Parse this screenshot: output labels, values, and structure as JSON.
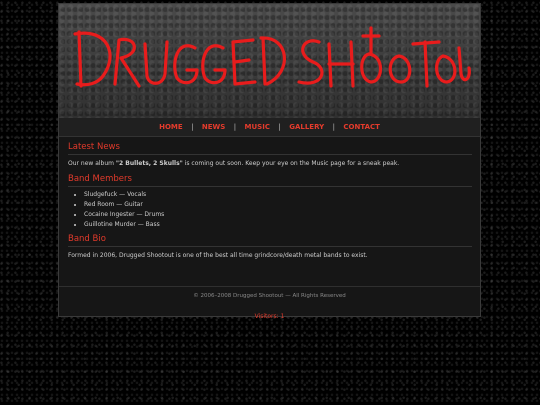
{
  "header": {
    "logo_text": "DRUGGED SHOOTOUT",
    "brand_color": "#e01f1f"
  },
  "nav": {
    "items": [
      {
        "label": "HOME"
      },
      {
        "label": "NEWS"
      },
      {
        "label": "MUSIC"
      },
      {
        "label": "GALLERY"
      },
      {
        "label": "CONTACT"
      }
    ],
    "separator": "|"
  },
  "news": {
    "heading": "Latest News",
    "text_before": "Our new album ",
    "album": "\"2 Bullets, 2 Skulls\"",
    "text_after": " is coming out soon. Keep your eye on the Music page for a sneak peak."
  },
  "members": {
    "heading": "Band Members",
    "items": [
      "Sludgefuck — Vocals",
      "Red Room — Guitar",
      "Cocaine Ingester — Drums",
      "Guillotine Murder — Bass"
    ]
  },
  "bio": {
    "heading": "Band Bio",
    "text": "Formed in 2006, Drugged Shootout is one of the best all time grindcore/death metal bands to exist."
  },
  "footer": {
    "copyright": "© 2006–2008 Drugged Shootout — All Rights Reserved",
    "visitors": "Visitors: 1"
  },
  "colors": {
    "accent": "#e43b2c",
    "background": "#000000",
    "panel": "#161616"
  }
}
